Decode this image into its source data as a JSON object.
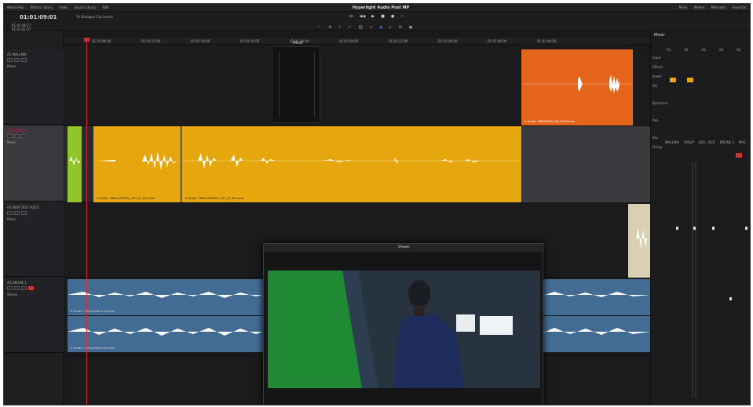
{
  "topbar": {
    "left_items": [
      "Media Pool",
      "Effects Library",
      "Index",
      "Sound Library",
      "ADR"
    ],
    "app_title": "Hyperlight Audio Post MP",
    "right_items": [
      "Mixer",
      "Meters",
      "Metadata",
      "Inspector"
    ]
  },
  "timecode": "01:01:09:01",
  "timeline_name": "1h Dialogue Clip Levels",
  "tc_list": [
    "01:01:04:27",
    "01:01:01:07",
    "00:00:00:00"
  ],
  "transport": [
    "⏮",
    "◀◀",
    "▶",
    "■",
    "●",
    "⟲"
  ],
  "edit_tools": [
    "↖",
    "✥",
    "⌇",
    "✂",
    "⛓",
    "⌖",
    "◆",
    "▸",
    "⊞",
    "●"
  ],
  "ruler_ticks": [
    "01:01:08:00",
    "01:01:12:00",
    "01:01:16:00",
    "01:01:20:00",
    "01:01:24:00",
    "01:01:28:00",
    "01:01:32:00",
    "01:01:36:00",
    "01:01:40:00",
    "01:01:44:00"
  ],
  "tracks": [
    {
      "id": "A1",
      "name": "WALLMIK",
      "format": "Mono",
      "clip_label": "A Grade · BRINKSDR_01R_0003.mov"
    },
    {
      "id": "A2",
      "name": "CHARLIE",
      "format": "Mono",
      "clip_label": "A Grade · BRKL1S3RN01_0ST_07_005.mov"
    },
    {
      "id": "A3",
      "name": "NEW TEST VOICE",
      "format": "Mono",
      "clip_label": ""
    },
    {
      "id": "A4",
      "name": "DRONE 1",
      "format": "Stereo",
      "clip_label": "A Grade · Edit gr Drone 1r4.wav"
    }
  ],
  "philip_label": "PHILIP",
  "viewer_title": "Viewer",
  "mixer": {
    "title": "Mixer",
    "channels": [
      "A1",
      "A2",
      "A3",
      "A4",
      "A5"
    ],
    "channel_names": [
      "WALLMIK",
      "PHILIP",
      "ADV...VICE",
      "DRONE 1",
      "MAS"
    ],
    "row_labels": [
      "Input",
      "Effects",
      "Insert",
      "EQ",
      "Dynamics",
      "Pan",
      "Bus",
      "Group"
    ]
  },
  "colors": {
    "orange_clip": "#e5651c",
    "yellow_clip": "#e6a60d",
    "green_clip": "#8fc42a",
    "blue_clip": "#426c94",
    "accent_red": "#e02b2b"
  }
}
